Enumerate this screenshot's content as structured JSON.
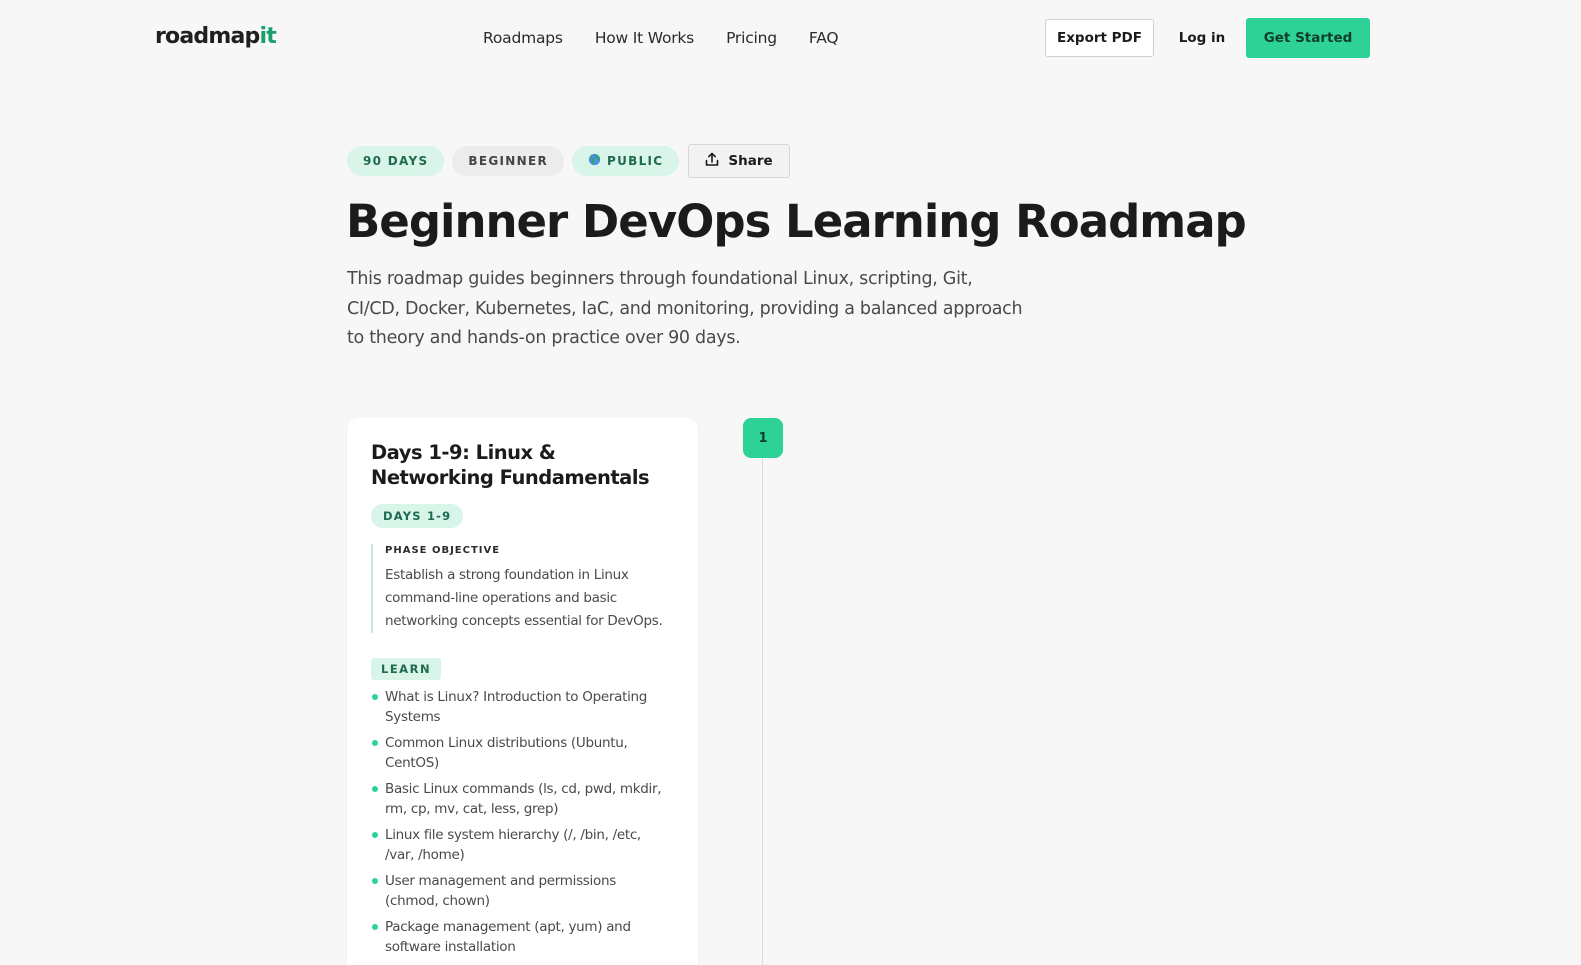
{
  "brand": {
    "logo_main": "roadmap",
    "logo_accent": "it",
    "accent_color": "#2ed196"
  },
  "nav": [
    "Roadmaps",
    "How It Works",
    "Pricing",
    "FAQ"
  ],
  "header_actions": {
    "export_label": "Export PDF",
    "login_label": "Log in",
    "start_label": "Get Started"
  },
  "tags": {
    "duration": "90 DAYS",
    "level": "BEGINNER",
    "visibility": "PUBLIC",
    "share_label": "Share"
  },
  "icons": {
    "visibility_icon": "globe-icon",
    "share_icon": "share-upload-icon"
  },
  "roadmap": {
    "title": "Beginner DevOps Learning Roadmap",
    "description": "This roadmap guides beginners through foundational Linux, scripting, Git, CI/CD, Docker, Kubernetes, IaC, and monitoring, providing a balanced approach to theory and hands-on practice over 90 days."
  },
  "phases": [
    {
      "number": "1",
      "title": "Days 1-9: Linux & Networking Fundamentals",
      "days_badge": "DAYS 1-9",
      "objective_label": "PHASE OBJECTIVE",
      "objective": "Establish a strong foundation in Linux command-line operations and basic networking concepts essential for DevOps.",
      "learn_label": "LEARN",
      "learn_items": [
        "What is Linux? Introduction to Operating Systems",
        "Common Linux distributions (Ubuntu, CentOS)",
        "Basic Linux commands (ls, cd, pwd, mkdir, rm, cp, mv, cat, less, grep)",
        "Linux file system hierarchy (/, /bin, /etc, /var, /home)",
        "User management and permissions (chmod, chown)",
        "Package management (apt, yum) and software installation"
      ]
    }
  ]
}
